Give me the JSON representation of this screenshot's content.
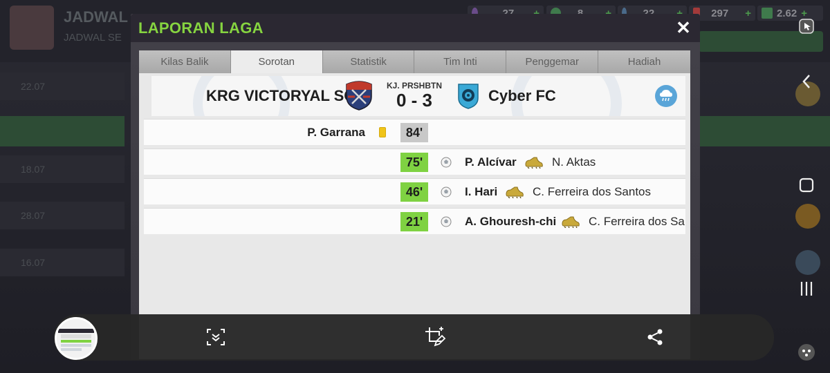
{
  "background": {
    "title": "JADWAL",
    "subtitle": "JADWAL SE",
    "resources": [
      {
        "value": "27"
      },
      {
        "value": "8"
      },
      {
        "value": "22"
      },
      {
        "value": "297"
      },
      {
        "value": "2.62"
      }
    ],
    "resource_plus": "+",
    "rows": [
      "22.07",
      "18.07",
      "28.07",
      "16.07",
      "16.07"
    ]
  },
  "modal": {
    "title": "LAPORAN LAGA",
    "close_label": "✕",
    "tabs": [
      {
        "label": "Kilas Balik",
        "active": false
      },
      {
        "label": "Sorotan",
        "active": true
      },
      {
        "label": "Statistik",
        "active": false
      },
      {
        "label": "Tim Inti",
        "active": false
      },
      {
        "label": "Penggemar",
        "active": false
      },
      {
        "label": "Hadiah",
        "active": false
      }
    ],
    "match": {
      "home_team": "KRG VICTORYAL SC",
      "away_team": "Cyber FC",
      "score_label": "KJ. PRSHBTN",
      "score": "0 - 3",
      "weather_icon": "rain-cloud-icon"
    },
    "events": [
      {
        "type": "yellow-card",
        "minute": "84'",
        "player": "P. Garrana",
        "side": "home"
      },
      {
        "type": "goal",
        "minute": "75'",
        "player": "P. Alcívar",
        "assist": "N. Aktas",
        "side": "away"
      },
      {
        "type": "goal",
        "minute": "46'",
        "player": "I. Hari",
        "assist": "C. Ferreira dos Santos",
        "side": "away"
      },
      {
        "type": "goal",
        "minute": "21'",
        "player": "A. Ghouresh-chi",
        "assist": "C. Ferreira dos Sa",
        "side": "away"
      }
    ]
  },
  "colors": {
    "title_green": "#86d440",
    "minute_green": "#7fd242",
    "minute_grey": "#c8c8c8",
    "header_dark": "#2b2832"
  },
  "toolbar": {
    "buttons": [
      "scroll-capture-icon",
      "crop-edit-icon",
      "share-icon"
    ]
  }
}
